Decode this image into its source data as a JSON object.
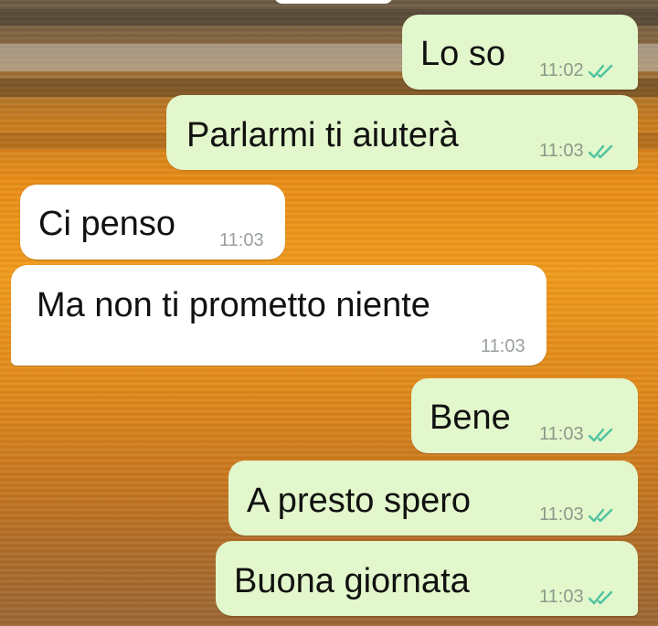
{
  "messages": [
    {
      "text": "Lo so",
      "time": "11:02",
      "direction": "out",
      "status": "read"
    },
    {
      "text": "Parlarmi ti aiuterà",
      "time": "11:03",
      "direction": "out",
      "status": "read"
    },
    {
      "text": "Ci penso",
      "time": "11:03",
      "direction": "in"
    },
    {
      "text": "Ma non ti prometto niente",
      "time": "11:03",
      "direction": "in"
    },
    {
      "text": "Bene",
      "time": "11:03",
      "direction": "out",
      "status": "read"
    },
    {
      "text": "A presto spero",
      "time": "11:03",
      "direction": "out",
      "status": "read"
    },
    {
      "text": "Buona giornata",
      "time": "11:03",
      "direction": "out",
      "status": "read"
    }
  ],
  "colors": {
    "outgoing_bubble": "#e2f7cb",
    "incoming_bubble": "#ffffff",
    "read_check": "#4fc3a1"
  },
  "icons": {
    "read_receipt": "double-check-icon"
  }
}
